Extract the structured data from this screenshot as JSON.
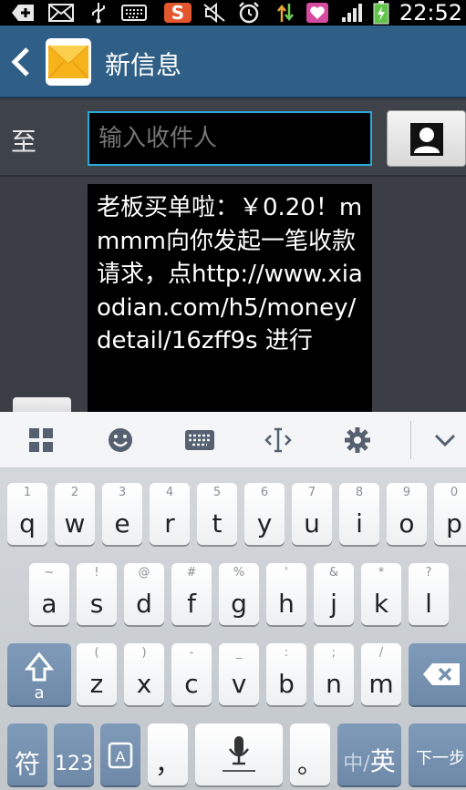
{
  "status_bar": {
    "time": "22:52",
    "icons": [
      "add-icon",
      "mail-icon",
      "usb-icon",
      "keyboard-icon",
      "app-s-icon",
      "silent-icon",
      "alarm-icon",
      "data-arrows-icon",
      "heart-app-icon",
      "signal-icon",
      "battery-charging-icon"
    ],
    "app_s_label": "S"
  },
  "action_bar": {
    "title": "新信息"
  },
  "recipient": {
    "label": "至",
    "placeholder": "输入收件人"
  },
  "message": {
    "text": "老板买单啦：￥0.20！mmmm向你发起一笔收款请求，点http://www.xiaodian.com/h5/money/detail/16zff9s 进行"
  },
  "keyboard": {
    "toolbar": [
      "grid-icon",
      "emoji-icon",
      "keyboard-icon",
      "cursor-icon",
      "settings-icon",
      "collapse-chevron-icon"
    ],
    "row1": [
      {
        "main": "q",
        "hint": "1"
      },
      {
        "main": "w",
        "hint": "2"
      },
      {
        "main": "e",
        "hint": "3"
      },
      {
        "main": "r",
        "hint": "4"
      },
      {
        "main": "t",
        "hint": "5"
      },
      {
        "main": "y",
        "hint": "6"
      },
      {
        "main": "u",
        "hint": "7"
      },
      {
        "main": "i",
        "hint": "8"
      },
      {
        "main": "o",
        "hint": "9"
      },
      {
        "main": "p",
        "hint": "0"
      }
    ],
    "row2": [
      {
        "main": "a",
        "hint": "~"
      },
      {
        "main": "s",
        "hint": "!"
      },
      {
        "main": "d",
        "hint": "@"
      },
      {
        "main": "f",
        "hint": "#"
      },
      {
        "main": "g",
        "hint": "%"
      },
      {
        "main": "h",
        "hint": "'"
      },
      {
        "main": "j",
        "hint": "&"
      },
      {
        "main": "k",
        "hint": "*"
      },
      {
        "main": "l",
        "hint": "?"
      }
    ],
    "row3": [
      {
        "main": "z",
        "hint": "("
      },
      {
        "main": "x",
        "hint": ")"
      },
      {
        "main": "c",
        "hint": "-"
      },
      {
        "main": "v",
        "hint": "_"
      },
      {
        "main": "b",
        "hint": ":"
      },
      {
        "main": "n",
        "hint": ";"
      },
      {
        "main": "m",
        "hint": "/"
      }
    ],
    "row4": {
      "symbols": "符",
      "numbers": "123",
      "comma": "，",
      "period": "。",
      "lang_cn": "中/",
      "lang_en": "英",
      "next": "下一步"
    }
  },
  "colors": {
    "action_bar": "#2f5f86",
    "input_border": "#2aa8d8",
    "dark_key": "#7592b0"
  }
}
